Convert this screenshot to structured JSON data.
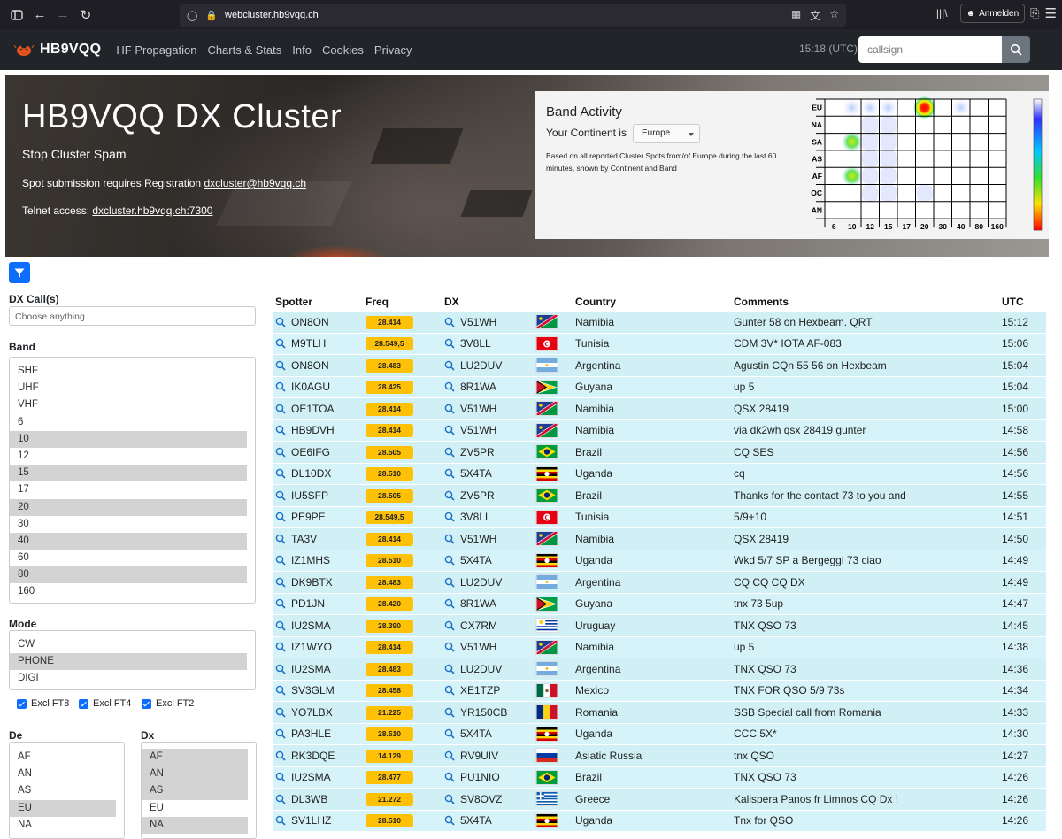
{
  "browser": {
    "url_host": "webcluster.hb9vqq.ch",
    "signin_label": "Anmelden"
  },
  "nav": {
    "brand": "HB9VQQ",
    "links": [
      "HF Propagation",
      "Charts & Stats",
      "Info",
      "Cookies",
      "Privacy"
    ],
    "time": "15:18 (UTC)",
    "search_placeholder": "callsign"
  },
  "hero": {
    "title": "HB9VQQ DX Cluster",
    "subtitle": "Stop Cluster Spam",
    "reg_text": "Spot submission requires Registration ",
    "reg_link": "dxcluster@hb9vqq.ch",
    "telnet_text": "Telnet access: ",
    "telnet_link": "dxcluster.hb9vqq.ch:7300"
  },
  "band_activity": {
    "title": "Band Activity",
    "continent_label": "Your Continent is",
    "continent_value": "Europe",
    "note": "Based on all reported Cluster Spots from/of Europe during the last 60 minutes, shown by Continent and Band",
    "rows": [
      "EU",
      "NA",
      "SA",
      "AS",
      "AF",
      "OC",
      "AN"
    ],
    "cols": [
      "6",
      "10",
      "12",
      "15",
      "17",
      "20",
      "30",
      "40",
      "80",
      "160"
    ],
    "scale_labels": [
      "0",
      "9",
      "11",
      "13",
      "19",
      "20"
    ],
    "hot": [
      [
        0,
        1,
        "l"
      ],
      [
        0,
        2,
        "l"
      ],
      [
        0,
        3,
        "l"
      ],
      [
        0,
        5,
        "hot"
      ],
      [
        0,
        7,
        "l"
      ],
      [
        1,
        2,
        "f"
      ],
      [
        1,
        3,
        "f"
      ],
      [
        2,
        1,
        "g"
      ],
      [
        2,
        2,
        "f"
      ],
      [
        2,
        3,
        "f"
      ],
      [
        3,
        2,
        "f"
      ],
      [
        3,
        3,
        "f"
      ],
      [
        4,
        1,
        "g"
      ],
      [
        4,
        2,
        "f"
      ],
      [
        4,
        3,
        "f"
      ],
      [
        5,
        2,
        "f"
      ],
      [
        5,
        3,
        "f"
      ],
      [
        5,
        5,
        "f"
      ]
    ]
  },
  "sidebar": {
    "dx_calls_label": "DX Call(s)",
    "dx_calls_placeholder": "Choose anything",
    "band_label": "Band",
    "bands": [
      {
        "v": "SHF",
        "s": false
      },
      {
        "v": "UHF",
        "s": false
      },
      {
        "v": "VHF",
        "s": false
      },
      {
        "v": "6",
        "s": false
      },
      {
        "v": "10",
        "s": true
      },
      {
        "v": "12",
        "s": false
      },
      {
        "v": "15",
        "s": true
      },
      {
        "v": "17",
        "s": false
      },
      {
        "v": "20",
        "s": true
      },
      {
        "v": "30",
        "s": false
      },
      {
        "v": "40",
        "s": true
      },
      {
        "v": "60",
        "s": false
      },
      {
        "v": "80",
        "s": true
      },
      {
        "v": "160",
        "s": false
      }
    ],
    "mode_label": "Mode",
    "modes": [
      {
        "v": "CW",
        "s": false
      },
      {
        "v": "PHONE",
        "s": true
      },
      {
        "v": "DIGI",
        "s": false
      }
    ],
    "excl": [
      "Excl FT8",
      "Excl FT4",
      "Excl FT2"
    ],
    "de_label": "De",
    "de": [
      {
        "v": "AF",
        "s": false
      },
      {
        "v": "AN",
        "s": false
      },
      {
        "v": "AS",
        "s": false
      },
      {
        "v": "EU",
        "s": true
      },
      {
        "v": "NA",
        "s": false
      }
    ],
    "dx_label": "Dx",
    "dx": [
      {
        "v": "AF",
        "s": true
      },
      {
        "v": "AN",
        "s": true
      },
      {
        "v": "AS",
        "s": true
      },
      {
        "v": "EU",
        "s": false
      },
      {
        "v": "NA",
        "s": true
      }
    ]
  },
  "table": {
    "headers": [
      "Spotter",
      "Freq",
      "DX",
      "",
      "Country",
      "Comments",
      "UTC"
    ],
    "rows": [
      [
        "ON8ON",
        "28.414",
        "V51WH",
        "namibia",
        "Namibia",
        "Gunter 58 on Hexbeam. QRT",
        "15:12"
      ],
      [
        "M9TLH",
        "28.549,5",
        "3V8LL",
        "tunisia",
        "Tunisia",
        "CDM 3V* IOTA AF-083",
        "15:06"
      ],
      [
        "ON8ON",
        "28.483",
        "LU2DUV",
        "argentina",
        "Argentina",
        "Agustin CQn 55 56 on Hexbeam",
        "15:04"
      ],
      [
        "IK0AGU",
        "28.425",
        "8R1WA",
        "guyana",
        "Guyana",
        "up 5",
        "15:04"
      ],
      [
        "OE1TOA",
        "28.414",
        "V51WH",
        "namibia",
        "Namibia",
        "QSX 28419",
        "15:00"
      ],
      [
        "HB9DVH",
        "28.414",
        "V51WH",
        "namibia",
        "Namibia",
        "via dk2wh qsx 28419 gunter",
        "14:58"
      ],
      [
        "OE6IFG",
        "28.505",
        "ZV5PR",
        "brazil",
        "Brazil",
        "CQ SES",
        "14:56"
      ],
      [
        "DL10DX",
        "28.510",
        "5X4TA",
        "uganda",
        "Uganda",
        "cq",
        "14:56"
      ],
      [
        "IU5SFP",
        "28.505",
        "ZV5PR",
        "brazil",
        "Brazil",
        "Thanks for the contact 73 to you and",
        "14:55"
      ],
      [
        "PE9PE",
        "28.549,5",
        "3V8LL",
        "tunisia",
        "Tunisia",
        "5/9+10",
        "14:51"
      ],
      [
        "TA3V",
        "28.414",
        "V51WH",
        "namibia",
        "Namibia",
        "QSX 28419",
        "14:50"
      ],
      [
        "IZ1MHS",
        "28.510",
        "5X4TA",
        "uganda",
        "Uganda",
        "Wkd 5/7 SP a Bergeggi 73 ciao",
        "14:49"
      ],
      [
        "DK9BTX",
        "28.483",
        "LU2DUV",
        "argentina",
        "Argentina",
        "CQ CQ CQ DX",
        "14:49"
      ],
      [
        "PD1JN",
        "28.420",
        "8R1WA",
        "guyana",
        "Guyana",
        "tnx 73 5up",
        "14:47"
      ],
      [
        "IU2SMA",
        "28.390",
        "CX7RM",
        "uruguay",
        "Uruguay",
        "TNX QSO 73",
        "14:45"
      ],
      [
        "IZ1WYO",
        "28.414",
        "V51WH",
        "namibia",
        "Namibia",
        "up 5",
        "14:38"
      ],
      [
        "IU2SMA",
        "28.483",
        "LU2DUV",
        "argentina",
        "Argentina",
        "TNX QSO 73",
        "14:36"
      ],
      [
        "SV3GLM",
        "28.458",
        "XE1TZP",
        "mexico",
        "Mexico",
        "TNX FOR QSO 5/9 73s",
        "14:34"
      ],
      [
        "YO7LBX",
        "21.225",
        "YR150CB",
        "romania",
        "Romania",
        "SSB Special call from Romania",
        "14:33"
      ],
      [
        "PA3HLE",
        "28.510",
        "5X4TA",
        "uganda",
        "Uganda",
        "CCC 5X*",
        "14:30"
      ],
      [
        "RK3DQE",
        "14.129",
        "RV9UIV",
        "russia",
        "Asiatic Russia",
        "tnx QSO",
        "14:27"
      ],
      [
        "IU2SMA",
        "28.477",
        "PU1NIO",
        "brazil",
        "Brazil",
        "TNX QSO 73",
        "14:26"
      ],
      [
        "DL3WB",
        "21.272",
        "SV8OVZ",
        "greece",
        "Greece",
        "Kalispera Panos fr Limnos CQ Dx !",
        "14:26"
      ],
      [
        "SV1LHZ",
        "28.510",
        "5X4TA",
        "uganda",
        "Uganda",
        "Tnx for QSO",
        "14:26"
      ]
    ]
  }
}
